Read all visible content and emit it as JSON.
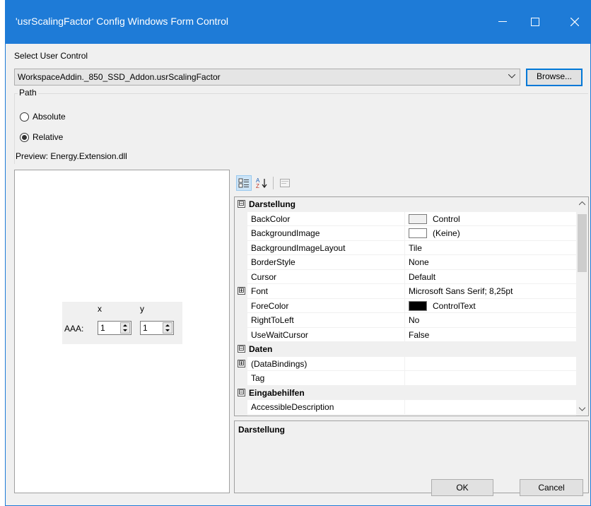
{
  "window": {
    "title": "'usrScalingFactor' Config Windows Form Control",
    "minimize_glyph": "—",
    "maximize_glyph": "☐",
    "close_glyph": "✕"
  },
  "select_control": {
    "label": "Select User Control",
    "value": "WorkspaceAddin._850_SSD_Addon.usrScalingFactor",
    "browse_label": "Browse..."
  },
  "path": {
    "legend": "Path",
    "options": [
      {
        "label": "Absolute",
        "checked": false
      },
      {
        "label": "Relative",
        "checked": true
      }
    ],
    "preview": "Preview: Energy.Extension.dll"
  },
  "user_control_preview": {
    "col_x": "x",
    "col_y": "y",
    "row_label": "AAA:",
    "x_value": "1",
    "y_value": "1"
  },
  "property_grid": {
    "toolbar": [
      "categorized-icon",
      "alphabetical-icon",
      "property-pages-icon"
    ],
    "rows": [
      {
        "type": "category",
        "expander": "⊟",
        "name": "Darstellung"
      },
      {
        "type": "prop",
        "name": "BackColor",
        "value": "Control",
        "swatch": "#f0f0f0"
      },
      {
        "type": "prop",
        "name": "BackgroundImage",
        "value": "(Keine)",
        "swatch": "#ffffff"
      },
      {
        "type": "prop",
        "name": "BackgroundImageLayout",
        "value": "Tile"
      },
      {
        "type": "prop",
        "name": "BorderStyle",
        "value": "None"
      },
      {
        "type": "prop",
        "name": "Cursor",
        "value": "Default"
      },
      {
        "type": "prop",
        "name": "Font",
        "value": "Microsoft Sans Serif; 8,25pt",
        "expander": "⊞"
      },
      {
        "type": "prop",
        "name": "ForeColor",
        "value": "ControlText",
        "swatch": "#000000"
      },
      {
        "type": "prop",
        "name": "RightToLeft",
        "value": "No"
      },
      {
        "type": "prop",
        "name": "UseWaitCursor",
        "value": "False"
      },
      {
        "type": "category",
        "expander": "⊟",
        "name": "Daten"
      },
      {
        "type": "prop",
        "name": "(DataBindings)",
        "value": "",
        "expander": "⊞"
      },
      {
        "type": "prop",
        "name": "Tag",
        "value": ""
      },
      {
        "type": "category",
        "expander": "⊟",
        "name": "Eingabehilfen"
      },
      {
        "type": "prop",
        "name": "AccessibleDescription",
        "value": ""
      }
    ],
    "description_title": "Darstellung"
  },
  "buttons": {
    "ok": "OK",
    "cancel": "Cancel"
  },
  "colors": {
    "titlebar": "#1e7bd7",
    "dialog_bg": "#f0f0f0",
    "accent": "#0078d7"
  }
}
